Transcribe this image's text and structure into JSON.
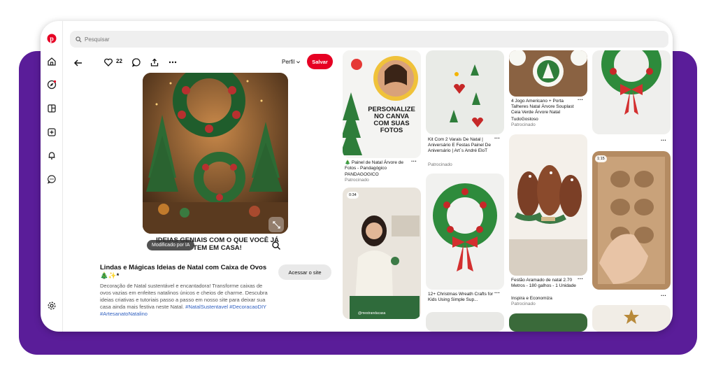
{
  "search": {
    "placeholder": "Pesquisar"
  },
  "pin": {
    "like_count": "22",
    "profile_label": "Perfil",
    "save_label": "Salvar",
    "image_caption": "IDEIAS GENIAIS COM O QUE VOCÊ JÁ TEM EM CASA!",
    "ai_badge": "Modificado por IA",
    "title": "Lindas e Mágicas Ideias de Natal com Caixa de Ovos 🎄✨*",
    "visit_label": "Acessar o site",
    "description": "Decoração de Natal sustentável e encantadora! Transforme caixas de ovos vazias em enfeites natalinos únicos e cheios de charme. Descubra ideias criativas e tutoriais passo a passo em nosso site para deixar sua casa ainda mais festiva neste Natal.",
    "tags": "#NatalSustentavel #DecoracaoDIY #ArtesanatoNatalino"
  },
  "feed": {
    "tile1": {
      "banner": [
        "PERSONALIZE",
        "NO CANVA",
        "COM SUAS",
        "FOTOS"
      ],
      "title": "🎄 Painel de Natal Árvore de Fotos - Pandagógico",
      "author": "PANDAGOGICO",
      "sponsored": "Patrocinado"
    },
    "tile2": {
      "badge": "0:34",
      "watermark": "@mestrandacasa"
    },
    "tile3": {
      "title": "Kit Com 2 Varais De Natal | Aniversário E Festas Painel De Aniversário | Art´s André EloT",
      "sponsored": "Patrocinado"
    },
    "tile4": {
      "title": "12+ Christmas Wreath Crafts for Kids Using Simple Sup..."
    },
    "tile5": {
      "title": "4 Jogo Americano + Porta Talheres Natal Árvore Souplast Ceia Verde Árvore Natal",
      "author": "TudoGostoso",
      "sponsored": "Patrocinado"
    },
    "tile6": {
      "title": "Festão Aramado de natal 2.70 Metros - 180 galhos - 1 Unidade",
      "author": "Inspira e Economiza",
      "sponsored": "Patrocinado"
    },
    "tile8": {
      "badge": "1:15"
    }
  }
}
